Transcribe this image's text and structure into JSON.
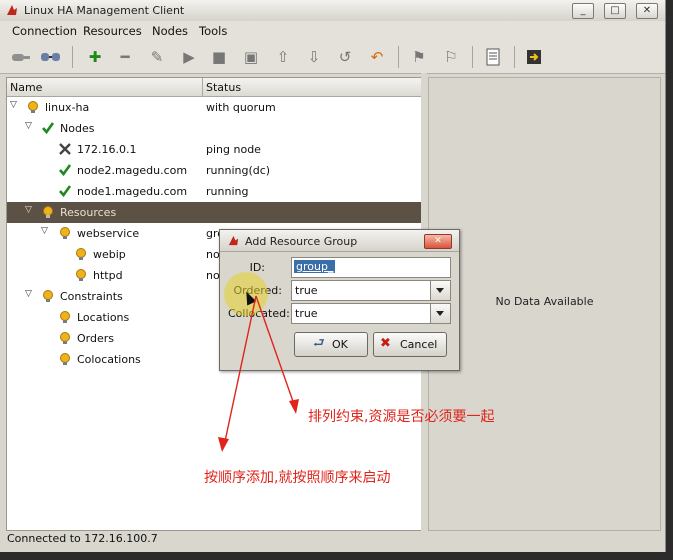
{
  "window": {
    "title": "Linux HA Management Client",
    "controls": [
      "_",
      "□",
      "✕"
    ]
  },
  "menu": [
    "Connection",
    "Resources",
    "Nodes",
    "Tools"
  ],
  "toolbar": {
    "icons": [
      "connect-icon",
      "disconnect-icon",
      "add-icon",
      "remove-icon",
      "cleanup-icon",
      "start-icon",
      "stop-icon",
      "standby-icon",
      "move-up-icon",
      "move-down-icon",
      "undo-icon",
      "redo-icon",
      "migrate-icon",
      "unmigrate-icon",
      "log-icon",
      "exit-icon"
    ]
  },
  "tree": {
    "columns": [
      "Name",
      "Status"
    ],
    "rows": [
      {
        "name": "linux-ha",
        "status": "with quorum",
        "icon": "bulb-icon",
        "expanded": true
      },
      {
        "name": "Nodes",
        "status": "",
        "icon": "check-icon",
        "expanded": true
      },
      {
        "name": "172.16.0.1",
        "status": "ping node",
        "icon": "tools-icon"
      },
      {
        "name": "node2.magedu.com",
        "status": "running(dc)",
        "icon": "check-icon"
      },
      {
        "name": "node1.magedu.com",
        "status": "running",
        "icon": "check-icon"
      },
      {
        "name": "Resources",
        "status": "",
        "icon": "bulb-icon",
        "expanded": true,
        "selected": true
      },
      {
        "name": "webservice",
        "status": "gro",
        "icon": "bulb-icon",
        "expanded": true
      },
      {
        "name": "webip",
        "status": "not",
        "icon": "bulb-icon"
      },
      {
        "name": "httpd",
        "status": "not",
        "icon": "bulb-icon"
      },
      {
        "name": "Constraints",
        "status": "",
        "icon": "bulb-icon",
        "expanded": true
      },
      {
        "name": "Locations",
        "status": "",
        "icon": "bulb-icon"
      },
      {
        "name": "Orders",
        "status": "",
        "icon": "bulb-icon"
      },
      {
        "name": "Colocations",
        "status": "",
        "icon": "bulb-icon"
      }
    ]
  },
  "right_pane": {
    "message": "No Data Available"
  },
  "status_bar": "Connected to 172.16.100.7",
  "dialog": {
    "title": "Add Resource Group",
    "id_label": "ID:",
    "id_value": "group_",
    "ordered_label": "Ordered:",
    "ordered_value": "true",
    "collocated_label": "Collocated:",
    "collocated_value": "true",
    "ok_label": "OK",
    "cancel_label": "Cancel"
  },
  "annotations": {
    "ordered_note": "排列约束,资源是否必须要一起",
    "collocated_note": "按顺序添加,就按照顺序来启动"
  },
  "colors": {
    "annotation": "#e0241b",
    "selection": "#5b5144"
  }
}
